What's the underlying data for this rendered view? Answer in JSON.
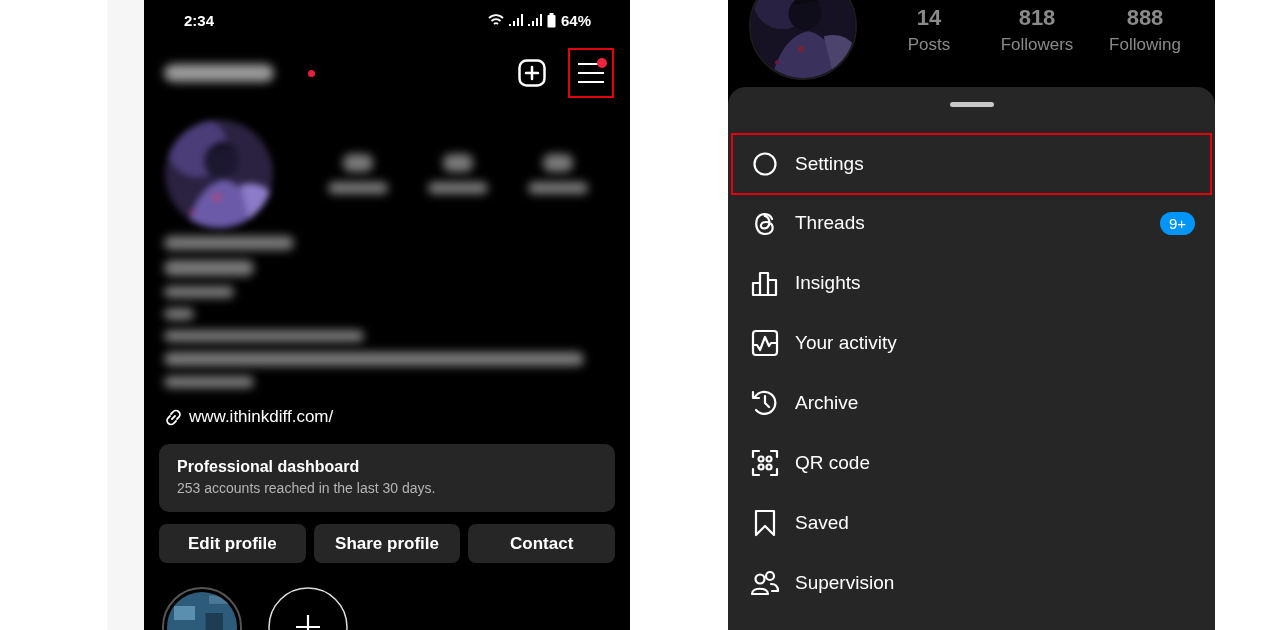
{
  "left_screen": {
    "status_bar": {
      "time": "2:34",
      "battery": "64%"
    },
    "header": {
      "account_dot": true,
      "menu_dot": true,
      "menu_highlighted": true
    },
    "link": "www.ithinkdiff.com/",
    "dashboard": {
      "title": "Professional dashboard",
      "subtitle": "253 accounts reached in the last 30 days."
    },
    "buttons": [
      "Edit profile",
      "Share profile",
      "Contact"
    ]
  },
  "right_screen": {
    "stats": [
      {
        "value": "14",
        "label": "Posts"
      },
      {
        "value": "818",
        "label": "Followers"
      },
      {
        "value": "888",
        "label": "Following"
      }
    ],
    "menu": [
      {
        "label": "Settings",
        "highlighted": true
      },
      {
        "label": "Threads",
        "highlighted": false,
        "badge": "9+"
      },
      {
        "label": "Insights",
        "highlighted": false
      },
      {
        "label": "Your activity",
        "highlighted": false
      },
      {
        "label": "Archive",
        "highlighted": false
      },
      {
        "label": "QR code",
        "highlighted": false
      },
      {
        "label": "Saved",
        "highlighted": false
      },
      {
        "label": "Supervision",
        "highlighted": false
      }
    ]
  }
}
